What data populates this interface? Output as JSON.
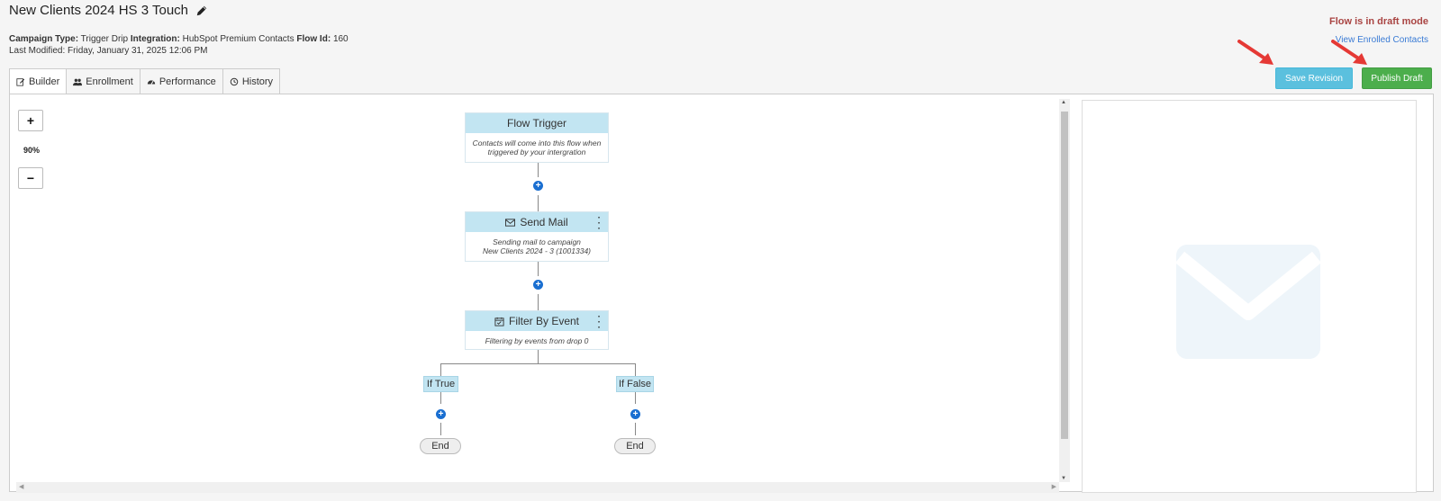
{
  "header": {
    "title": "New Clients 2024 HS 3 Touch",
    "campaign_type_label": "Campaign Type:",
    "campaign_type_value": "Trigger Drip",
    "integration_label": "Integration:",
    "integration_value": "HubSpot Premium Contacts",
    "flow_id_label": "Flow Id:",
    "flow_id_value": "160",
    "last_modified": "Last Modified: Friday, January 31, 2025 12:06 PM"
  },
  "status": {
    "draft_message": "Flow is in draft mode",
    "enrolled_link": "View Enrolled Contacts"
  },
  "actions": {
    "save_label": "Save Revision",
    "publish_label": "Publish Draft"
  },
  "tabs": [
    {
      "label": "Builder",
      "icon": "edit-icon",
      "active": true
    },
    {
      "label": "Enrollment",
      "icon": "users-icon",
      "active": false
    },
    {
      "label": "Performance",
      "icon": "dashboard-icon",
      "active": false
    },
    {
      "label": "History",
      "icon": "history-icon",
      "active": false
    }
  ],
  "zoom": {
    "in_label": "+",
    "out_label": "−",
    "level": "90%"
  },
  "flow": {
    "trigger": {
      "title": "Flow Trigger",
      "desc_line1": "Contacts will come into this flow when",
      "desc_line2": "triggered by your intergration"
    },
    "send_mail": {
      "title": "Send Mail",
      "icon": "envelope-icon",
      "desc_line1": "Sending mail to campaign",
      "desc_line2": "New Clients 2024 - 3 (1001334)"
    },
    "filter": {
      "title": "Filter By Event",
      "icon": "calendar-check-icon",
      "desc_line1": "Filtering by events from drop 0"
    },
    "if_true": "If True",
    "if_false": "If False",
    "end_label": "End"
  },
  "colors": {
    "node_header": "#c2e5f2",
    "add_button": "#1a6fd1",
    "save_button": "#5bc0de",
    "publish_button": "#4cae4c",
    "draft_text": "#a94442",
    "arrow": "#e53935"
  }
}
